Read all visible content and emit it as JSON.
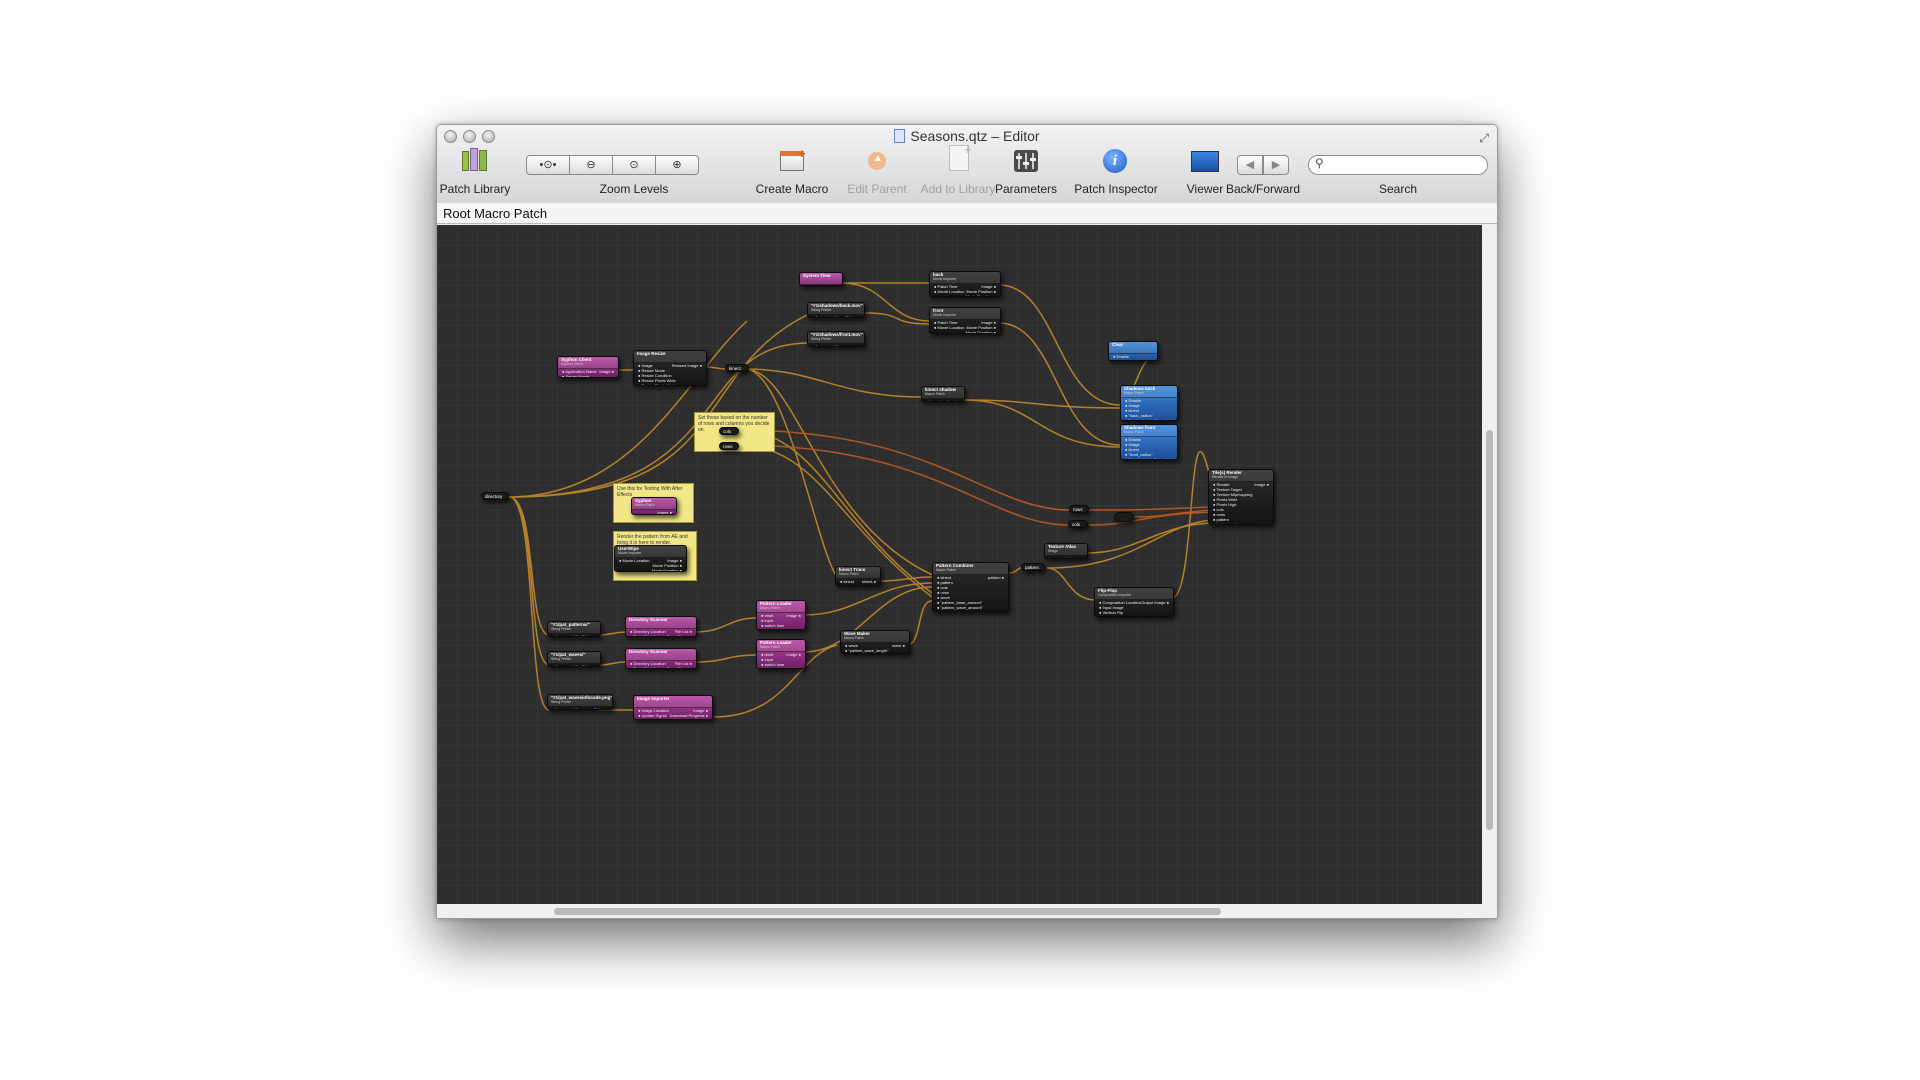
{
  "window": {
    "title": "Seasons.qtz – Editor",
    "breadcrumb": "Root Macro Patch"
  },
  "toolbar": {
    "patch_library": "Patch Library",
    "zoom_levels": "Zoom Levels",
    "create_macro": "Create Macro",
    "edit_parent": "Edit Parent",
    "add_to_library": "Add to Library",
    "parameters": "Parameters",
    "patch_inspector": "Patch Inspector",
    "viewer": "Viewer",
    "back_forward": "Back/Forward",
    "search": "Search"
  },
  "nodes": {
    "system_time": {
      "title": "System Time",
      "outputs": [
        "Time"
      ]
    },
    "back_player": {
      "title": "back",
      "subtitle": "Movie Importer",
      "inputs": [
        "Patch Time",
        "Movie Location"
      ],
      "outputs": [
        "Image",
        "Movie Position",
        "Movie Duration"
      ]
    },
    "front_player": {
      "title": "front",
      "subtitle": "Movie Importer",
      "inputs": [
        "Patch Time",
        "Movie Location"
      ],
      "outputs": [
        "Image",
        "Movie Position",
        "Movie Duration"
      ]
    },
    "string_back": {
      "title": "\"#1/shadows/back.mov\"",
      "subtitle": "String Printer",
      "inputs": [
        "Argument #1"
      ],
      "outputs": [
        "String"
      ]
    },
    "string_front": {
      "title": "\"#1/shadows/front.mov\"",
      "subtitle": "String Printer",
      "inputs": [
        "Argument #1"
      ]
    },
    "clear": {
      "title": "Clear",
      "inputs": [
        "Enable",
        "Clear Color"
      ]
    },
    "syphon_client": {
      "title": "Syphon Client",
      "subtitle": "Syphon Client",
      "inputs": [
        "Application Name",
        "Server Name"
      ],
      "outputs": [
        "Image"
      ]
    },
    "image_resize": {
      "title": "Image Resize",
      "inputs": [
        "Image",
        "Resize Mode",
        "Resize Condition",
        "Resize Pixels Wide",
        "Resize Pixels High"
      ],
      "outputs": [
        "Resized Image"
      ]
    },
    "kinect_label": "kinect",
    "kinect_shadow": {
      "title": "kinect shadow",
      "subtitle": "Macro Patch",
      "inputs": [
        "kinect"
      ],
      "outputs": [
        "kinect"
      ]
    },
    "shadows_back": {
      "title": "Shadows back",
      "subtitle": "Macro Patch",
      "inputs": [
        "Enable",
        "Image",
        "kinect",
        "\"back_radius\"",
        "\"back_shadowPower\""
      ]
    },
    "shadows_front": {
      "title": "Shadows front",
      "subtitle": "Macro Patch",
      "inputs": [
        "Enable",
        "Image",
        "kinect",
        "\"front_radius\"",
        "\"front_shadowPower\""
      ]
    },
    "note_rows": "Set these based on the number of rows and columns you decide on.",
    "cols_label": "cols",
    "rows_label": "rows",
    "note_ae": "Use this for Testing With After Effects",
    "syphon_ae": {
      "title": "Syphon",
      "subtitle": "Macro Patch",
      "outputs": [
        "Image"
      ]
    },
    "note_pattern": "Render the pattern from AE and bring it in here to render.",
    "userwipe": {
      "title": "UserWipe",
      "subtitle": "Movie Importer",
      "inputs": [
        "Movie Location"
      ],
      "outputs": [
        "Image",
        "Movie Position",
        "Movie Duration"
      ]
    },
    "directory": "directory",
    "string_patterns": {
      "title": "\"#1/pat_patterns/\"",
      "subtitle": "String Printer",
      "inputs": [
        "Argument #1"
      ],
      "outputs": [
        "String"
      ]
    },
    "string_waves": {
      "title": "\"#1/pat_waves/\"",
      "subtitle": "String Printer",
      "inputs": [
        "Argument #1"
      ],
      "outputs": [
        "String"
      ]
    },
    "string_png": {
      "title": "\"#1/pat_wavesinfocode.png\"",
      "subtitle": "String Printer",
      "inputs": [
        "Argument #1"
      ],
      "outputs": [
        "String"
      ]
    },
    "dir_scanner_1": {
      "title": "Directory Scanner",
      "inputs": [
        "Directory Location",
        "Scan Signal"
      ],
      "outputs": [
        "File List",
        "Done Signal"
      ]
    },
    "dir_scanner_2": {
      "title": "Directory Scanner",
      "inputs": [
        "Directory Location",
        "Scan Signal"
      ],
      "outputs": [
        "File List",
        "Done Signal"
      ]
    },
    "pattern_loader_1": {
      "title": "Pattern Loader",
      "subtitle": "Macro Patch",
      "inputs": [
        "reset",
        "input",
        "switch time",
        "tween time"
      ],
      "outputs": [
        "Image"
      ]
    },
    "pattern_loader_2": {
      "title": "Pattern Loader",
      "subtitle": "Macro Patch",
      "inputs": [
        "reset",
        "input",
        "switch time",
        "tween time"
      ],
      "outputs": [
        "Image"
      ]
    },
    "image_importer": {
      "title": "Image Importer",
      "inputs": [
        "Image Location",
        "Update Signal"
      ],
      "outputs": [
        "Image",
        "Download Progress",
        "Done Signal"
      ]
    },
    "kinect_trans": {
      "title": "kinect Trans",
      "subtitle": "Macro Patch",
      "inputs": [
        "kinect",
        "mix"
      ],
      "outputs": [
        "kinect"
      ]
    },
    "wave_maker": {
      "title": "Wave Maker",
      "subtitle": "Macro Patch",
      "inputs": [
        "wave",
        "\"pattern_wave_length\"",
        "\"pattern_wave_speed\""
      ],
      "outputs": [
        "wave"
      ]
    },
    "pattern_combiner": {
      "title": "Pattern Combiner",
      "subtitle": "Macro Patch",
      "inputs": [
        "kinect",
        "pattern",
        "cols",
        "rows",
        "wave",
        "\"pattern_base_amount\"",
        "\"pattern_wave_amount\"",
        "\"pattern_kinect_amount\""
      ],
      "outputs": [
        "pattern"
      ]
    },
    "pattern_label": "pattern",
    "texture_atlas": {
      "title": "Texture Atlas",
      "subtitle": "Image",
      "outputs": [
        "Images"
      ]
    },
    "flip_flop": {
      "title": "Flip-Flop",
      "subtitle": "Composition Importer",
      "inputs": [
        "Composition Location",
        "Input Image",
        "Vertical Flip",
        "Horizontal Flip"
      ],
      "outputs": [
        "Output Image"
      ]
    },
    "rows_label2": "rows",
    "cols_label2": "cols",
    "tiles_render": {
      "title": "Tile(s) Render",
      "subtitle": "Render In Image",
      "inputs": [
        "Render",
        "Texture Target",
        "Texture Mipmapping",
        "Pixels Wide",
        "Pixels High",
        "cols",
        "rows",
        "pattern",
        "texture pack"
      ],
      "outputs": [
        "Image"
      ]
    }
  },
  "colors": {
    "canvas": "#2e2e2e",
    "wire_yellow": "#c48b2b",
    "wire_orange": "#b65a20",
    "node_purple": "#9a3388",
    "node_blue": "#2f6fc4",
    "note_yellow": "#f1e786"
  }
}
